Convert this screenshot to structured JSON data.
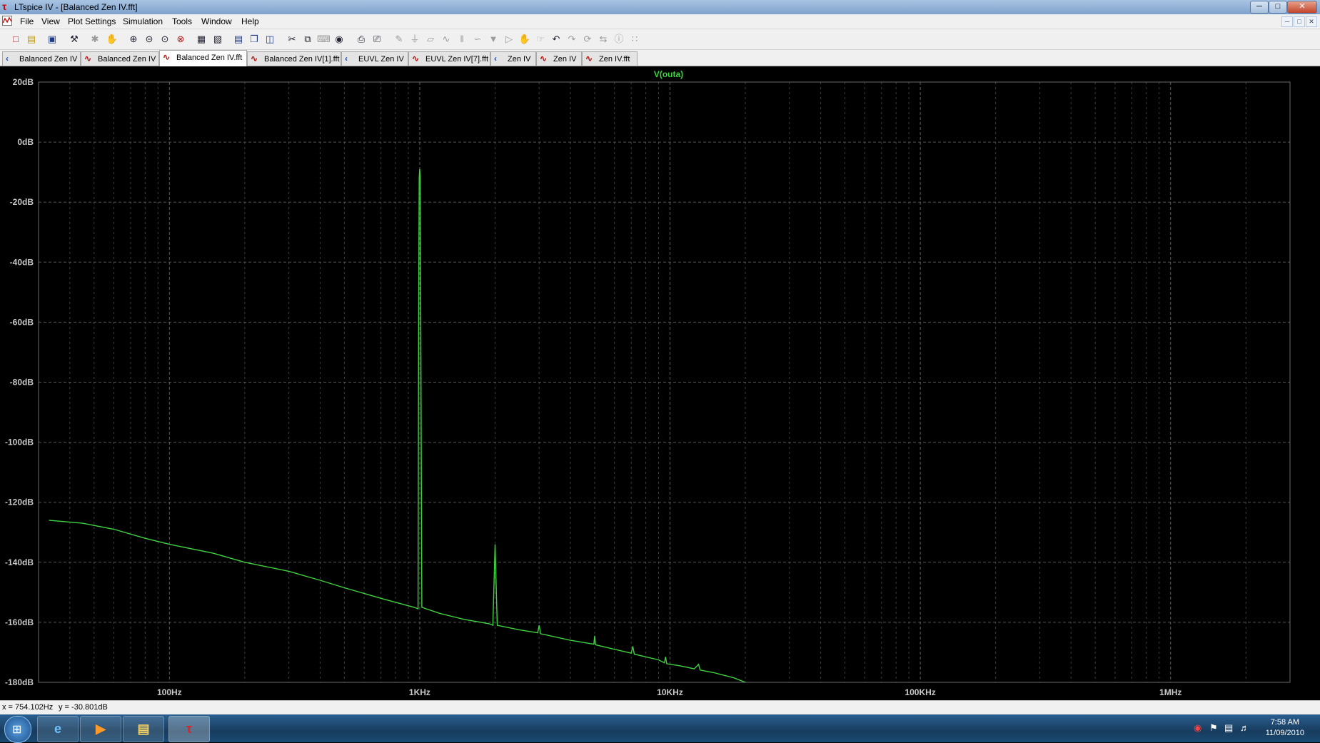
{
  "window": {
    "title": "LTspice IV - [Balanced Zen IV.fft]",
    "buttons": {
      "minimize": "─",
      "maximize": "□",
      "close": "✕"
    }
  },
  "menu": {
    "items": [
      "File",
      "View",
      "Plot Settings",
      "Simulation",
      "Tools",
      "Window",
      "Help"
    ]
  },
  "tabs": [
    {
      "label": "Balanced Zen IV",
      "kind": "schematic",
      "active": false
    },
    {
      "label": "Balanced Zen IV",
      "kind": "waveform",
      "active": false
    },
    {
      "label": "Balanced Zen IV.fft",
      "kind": "waveform",
      "active": true
    },
    {
      "label": "Balanced Zen IV[1].fft",
      "kind": "waveform",
      "active": false
    },
    {
      "label": "EUVL Zen IV",
      "kind": "schematic",
      "active": false
    },
    {
      "label": "EUVL Zen IV[7].fft",
      "kind": "waveform",
      "active": false
    },
    {
      "label": "Zen IV",
      "kind": "schematic",
      "active": false
    },
    {
      "label": "Zen IV",
      "kind": "waveform",
      "active": false
    },
    {
      "label": "Zen IV.fft",
      "kind": "waveform",
      "active": false
    }
  ],
  "toolbar": {
    "icons": [
      "new-schematic-icon",
      "open-icon",
      "save-icon",
      "control-panel-icon",
      "run-icon",
      "halt-icon",
      "zoom-in-icon",
      "zoom-out-icon",
      "zoom-full-icon",
      "zoom-cancel-icon",
      "autorange-icon",
      "fit-icon",
      "tile-horizontal-icon",
      "cascade-icon",
      "tile-vertical-icon",
      "cut-icon",
      "copy-icon",
      "paste-icon",
      "find-icon",
      "print-icon",
      "print-setup-icon",
      "wire-icon",
      "ground-icon",
      "label-icon",
      "resistor-icon",
      "capacitor-icon",
      "inductor-icon",
      "diode-icon",
      "component-icon",
      "move-icon",
      "drag-icon",
      "undo-icon",
      "redo-icon",
      "rotate-icon",
      "mirror-icon",
      "text-icon",
      "spice-directive-icon"
    ]
  },
  "status": {
    "x_readout": "x = 754.102Hz",
    "y_readout": "y = -30.801dB"
  },
  "taskbar": {
    "start_glyph": "⊞",
    "tasks": [
      {
        "name": "ie-task-icon",
        "glyph": "e"
      },
      {
        "name": "media-player-task-icon",
        "glyph": "▶"
      },
      {
        "name": "explorer-task-icon",
        "glyph": "▤"
      },
      {
        "name": "ltspice-task-icon",
        "glyph": "τ"
      }
    ],
    "time": "7:58 AM",
    "date": "11/09/2010"
  },
  "chart_data": {
    "type": "line",
    "trace_label": "V(outa)",
    "x_scale": "log",
    "xlim": [
      30,
      3000000
    ],
    "ylim": [
      -180,
      20
    ],
    "x_ticks": [
      {
        "value": 100,
        "label": "100Hz"
      },
      {
        "value": 1000,
        "label": "1KHz"
      },
      {
        "value": 10000,
        "label": "10KHz"
      },
      {
        "value": 100000,
        "label": "100KHz"
      },
      {
        "value": 1000000,
        "label": "1MHz"
      }
    ],
    "y_ticks": [
      {
        "value": 20,
        "label": "20dB"
      },
      {
        "value": 0,
        "label": "0dB"
      },
      {
        "value": -20,
        "label": "-20dB"
      },
      {
        "value": -40,
        "label": "-40dB"
      },
      {
        "value": -60,
        "label": "-60dB"
      },
      {
        "value": -80,
        "label": "-80dB"
      },
      {
        "value": -100,
        "label": "-100dB"
      },
      {
        "value": -120,
        "label": "-120dB"
      },
      {
        "value": -140,
        "label": "-140dB"
      },
      {
        "value": -160,
        "label": "-160dB"
      },
      {
        "value": -180,
        "label": "-180dB"
      }
    ],
    "grid": true,
    "colors": {
      "trace": "#3fd23f",
      "grid": "#6a6a6a",
      "label": "#c8c8c8",
      "background": "#000000"
    },
    "series": [
      {
        "name": "V(outa)",
        "points": [
          [
            33,
            -126
          ],
          [
            45,
            -127
          ],
          [
            60,
            -129
          ],
          [
            80,
            -132
          ],
          [
            100,
            -134
          ],
          [
            150,
            -137
          ],
          [
            200,
            -140
          ],
          [
            300,
            -143
          ],
          [
            400,
            -146
          ],
          [
            500,
            -148.5
          ],
          [
            700,
            -152
          ],
          [
            950,
            -155
          ],
          [
            985,
            -155.5
          ],
          [
            990,
            -60
          ],
          [
            995,
            -12
          ],
          [
            1000,
            -9
          ],
          [
            1005,
            -12
          ],
          [
            1010,
            -60
          ],
          [
            1020,
            -155
          ],
          [
            1200,
            -157
          ],
          [
            1500,
            -159
          ],
          [
            1900,
            -160.5
          ],
          [
            1960,
            -161
          ],
          [
            2000,
            -134
          ],
          [
            2040,
            -161
          ],
          [
            2500,
            -162.5
          ],
          [
            2960,
            -163.5
          ],
          [
            3000,
            -161
          ],
          [
            3040,
            -163.8
          ],
          [
            4000,
            -166
          ],
          [
            4960,
            -167.3
          ],
          [
            5000,
            -164.5
          ],
          [
            5040,
            -167.5
          ],
          [
            6000,
            -169
          ],
          [
            7000,
            -170.3
          ],
          [
            7100,
            -168
          ],
          [
            7200,
            -170.6
          ],
          [
            8000,
            -171.5
          ],
          [
            9000,
            -172.5
          ],
          [
            9500,
            -173.5
          ],
          [
            9600,
            -171.5
          ],
          [
            9700,
            -173.8
          ],
          [
            11000,
            -174.5
          ],
          [
            12500,
            -175.5
          ],
          [
            13000,
            -174
          ],
          [
            13200,
            -175.9
          ],
          [
            15000,
            -176.8
          ],
          [
            18000,
            -178.5
          ],
          [
            20000,
            -180
          ]
        ]
      }
    ]
  }
}
